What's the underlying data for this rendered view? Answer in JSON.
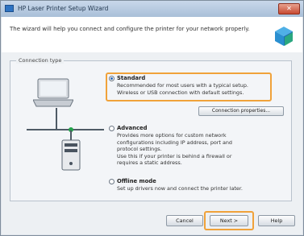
{
  "window": {
    "title": "HP Laser Printer Setup Wizard",
    "close_label": "✕"
  },
  "header": {
    "description": "The wizard will help you connect and configure the printer for your network properly."
  },
  "group": {
    "label": "Connection type"
  },
  "options": [
    {
      "title": "Standard",
      "desc_lines": [
        "Recommended for most users with a typical setup.",
        "Wireless or USB connection with default settings."
      ],
      "selected": true
    },
    {
      "title": "Advanced",
      "desc_lines": [
        "Provides more options for custom network",
        "configurations including IP address, port and",
        "protocol settings.",
        "Use this if your printer is behind a firewall or",
        "requires a static address."
      ],
      "selected": false
    },
    {
      "title": "Offline mode",
      "desc_lines": [
        "Set up drivers now and connect the printer later."
      ],
      "selected": false
    }
  ],
  "properties_button": "Connection properties...",
  "buttons": {
    "cancel": "Cancel",
    "next": "Next >",
    "help": "Help"
  },
  "colors": {
    "highlight": "#f0a23a",
    "accent": "#2c69b6"
  }
}
